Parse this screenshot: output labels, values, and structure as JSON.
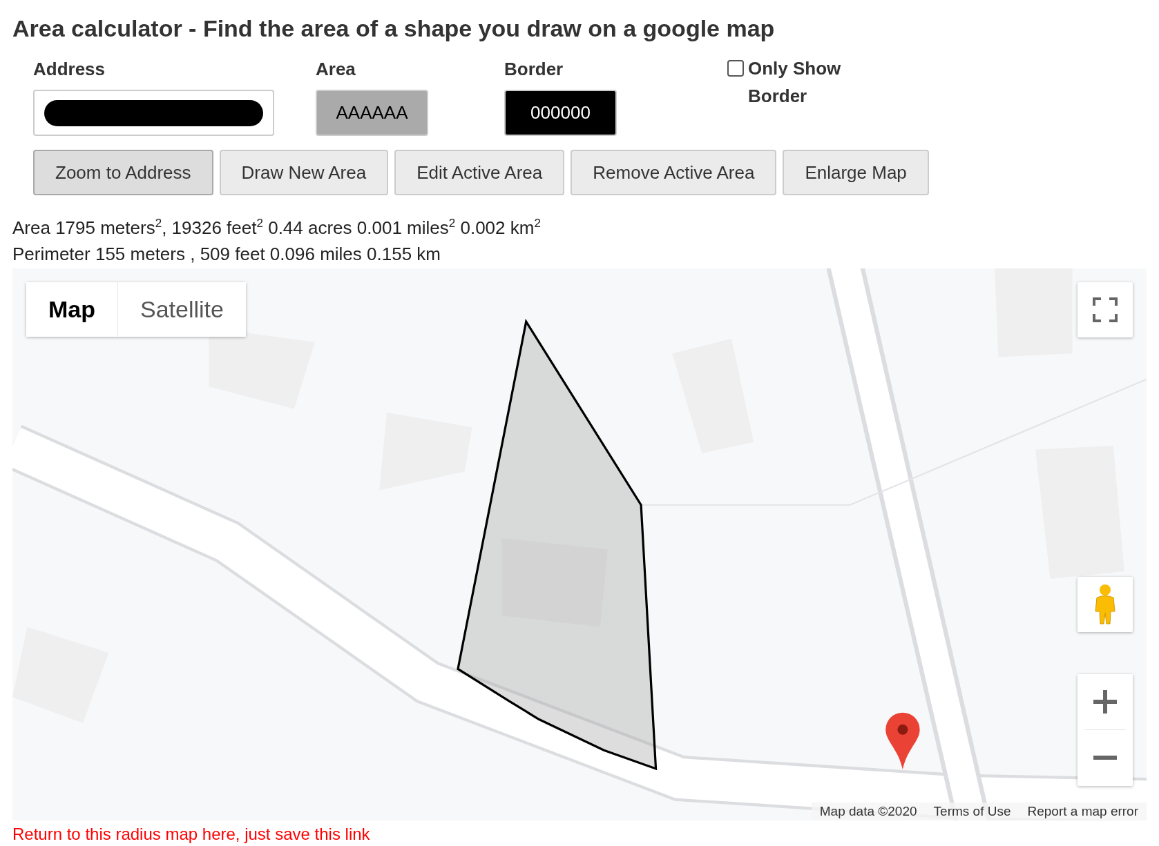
{
  "title": "Area calculator - Find the area of a shape you draw on a google map",
  "fields": [
    {
      "kind": "address",
      "label": "Address",
      "redacted": true
    },
    {
      "kind": "color",
      "label": "Area",
      "value": "AAAAAA"
    },
    {
      "kind": "color",
      "label": "Border",
      "value": "000000"
    }
  ],
  "only_show_border": {
    "label": "Only Show Border",
    "checked": false
  },
  "buttons": [
    {
      "label": "Zoom to Address",
      "pressed": true
    },
    {
      "label": "Draw New Area",
      "pressed": false
    },
    {
      "label": "Edit Active Area",
      "pressed": false
    },
    {
      "label": "Remove Active Area",
      "pressed": false
    },
    {
      "label": "Enlarge Map",
      "pressed": false
    }
  ],
  "results": [
    "Area 1795 meters$^{2}$, 19326 feet$^{2}$ 0.44 acres 0.001 miles$^{2}$ 0.002 km$^{2}$",
    "Perimeter 155 meters , 509 feet 0.096 miles 0.155 km"
  ],
  "map": {
    "kind": "picture",
    "type_tabs": [
      {
        "label": "Map",
        "selected": true
      },
      {
        "label": "Satellite",
        "selected": false
      }
    ],
    "attribution": [
      "Map data ©2020",
      "Terms of Use",
      "Report a map error"
    ]
  },
  "footer_link": "Return to this radius map here, just save this link"
}
